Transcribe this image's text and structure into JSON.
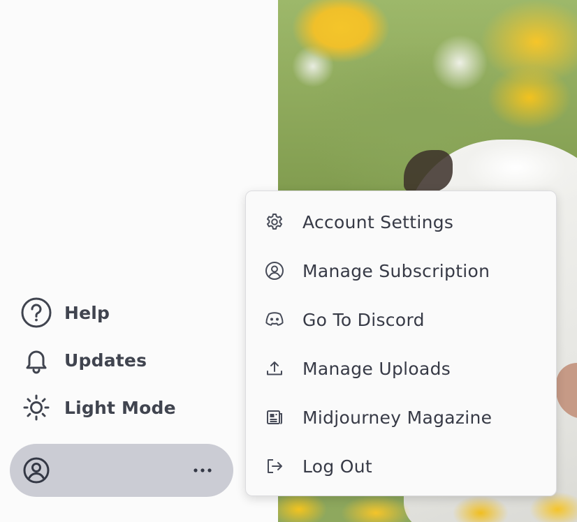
{
  "sidebar": {
    "items": [
      {
        "label": "Help",
        "icon": "help-circle-icon"
      },
      {
        "label": "Updates",
        "icon": "bell-icon"
      },
      {
        "label": "Light Mode",
        "icon": "sun-icon"
      }
    ],
    "account": {
      "avatar_icon": "user-circle-icon",
      "more_icon": "more-dots-icon"
    }
  },
  "menu": {
    "items": [
      {
        "label": "Account Settings",
        "icon": "gear-icon"
      },
      {
        "label": "Manage Subscription",
        "icon": "user-circle-icon"
      },
      {
        "label": "Go To Discord",
        "icon": "discord-icon"
      },
      {
        "label": "Manage Uploads",
        "icon": "upload-icon"
      },
      {
        "label": "Midjourney Magazine",
        "icon": "magazine-icon"
      },
      {
        "label": "Log Out",
        "icon": "logout-icon"
      }
    ]
  },
  "colors": {
    "sidebar_bg": "#fbfbfb",
    "account_bar_bg": "#cbccd4",
    "text": "#40444f",
    "menu_bg": "#fafafa"
  }
}
